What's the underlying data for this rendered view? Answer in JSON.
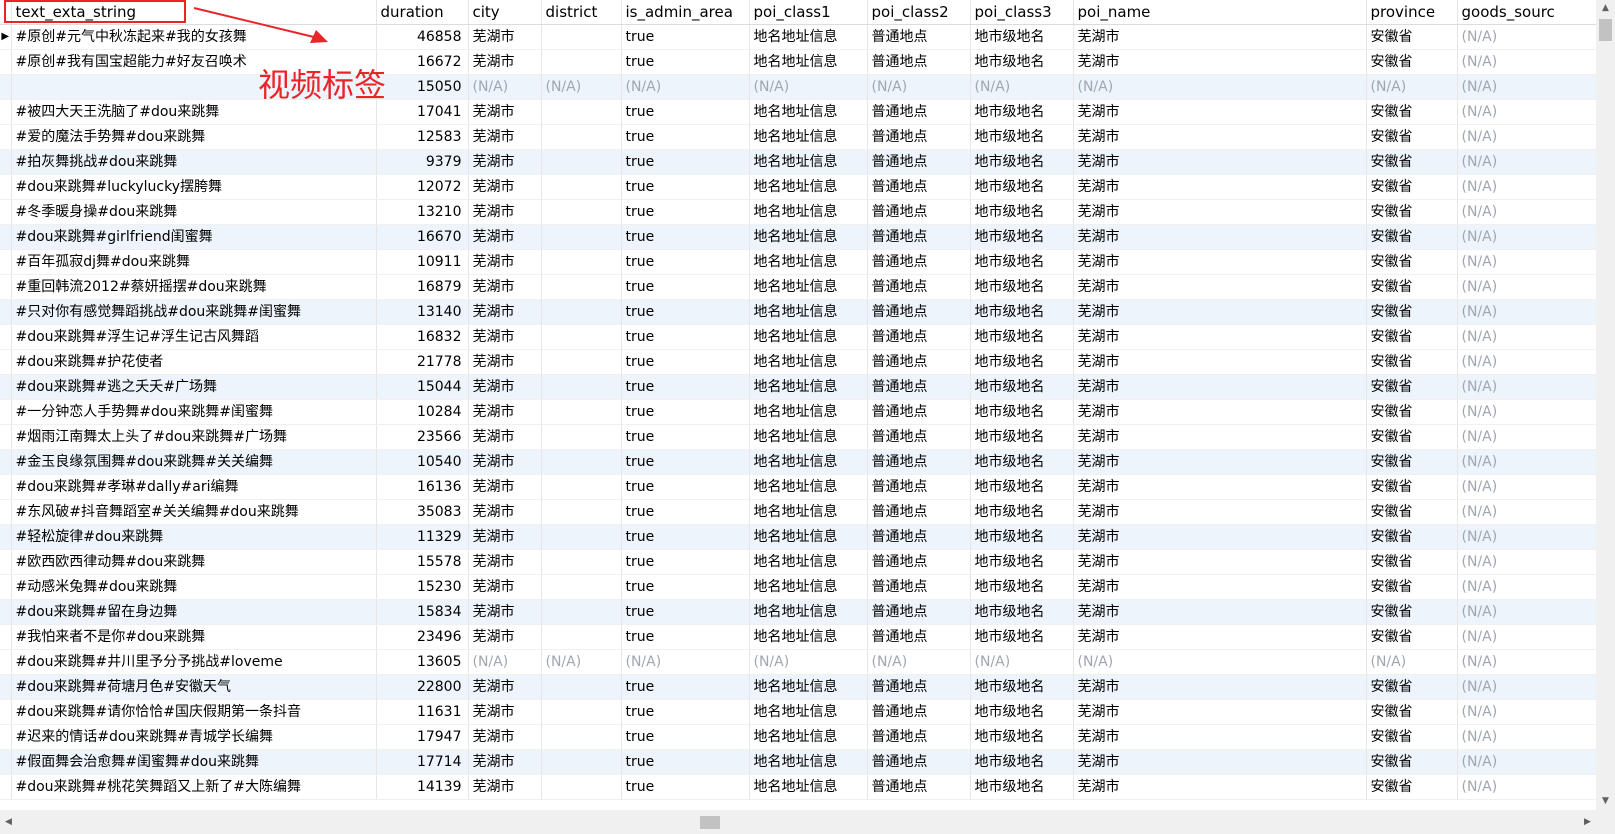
{
  "columns": [
    "text_exta_string",
    "duration",
    "city",
    "district",
    "is_admin_area",
    "poi_class1",
    "poi_class2",
    "poi_class3",
    "poi_name",
    "province",
    "goods_sourc"
  ],
  "na": "(N/A)",
  "annotation": {
    "label": "视频标签",
    "color": "#e8262a"
  },
  "rows": [
    [
      "#原创#元气中秋冻起来#我的女孩舞",
      "46858",
      "芜湖市",
      "",
      "true",
      "地名地址信息",
      "普通地点",
      "地市级地名",
      "芜湖市",
      "安徽省",
      "(N/A)"
    ],
    [
      "#原创#我有国宝超能力#好友召唤术",
      "16672",
      "芜湖市",
      "",
      "true",
      "地名地址信息",
      "普通地点",
      "地市级地名",
      "芜湖市",
      "安徽省",
      "(N/A)"
    ],
    [
      "",
      "15050",
      "(N/A)",
      "(N/A)",
      "(N/A)",
      "(N/A)",
      "(N/A)",
      "(N/A)",
      "(N/A)",
      "(N/A)",
      "(N/A)"
    ],
    [
      "#被四大天王洗脑了#dou来跳舞",
      "17041",
      "芜湖市",
      "",
      "true",
      "地名地址信息",
      "普通地点",
      "地市级地名",
      "芜湖市",
      "安徽省",
      "(N/A)"
    ],
    [
      "#爱的魔法手势舞#dou来跳舞",
      "12583",
      "芜湖市",
      "",
      "true",
      "地名地址信息",
      "普通地点",
      "地市级地名",
      "芜湖市",
      "安徽省",
      "(N/A)"
    ],
    [
      "#拍灰舞挑战#dou来跳舞",
      "9379",
      "芜湖市",
      "",
      "true",
      "地名地址信息",
      "普通地点",
      "地市级地名",
      "芜湖市",
      "安徽省",
      "(N/A)"
    ],
    [
      "#dou来跳舞#luckylucky摆胯舞",
      "12072",
      "芜湖市",
      "",
      "true",
      "地名地址信息",
      "普通地点",
      "地市级地名",
      "芜湖市",
      "安徽省",
      "(N/A)"
    ],
    [
      "#冬季暖身操#dou来跳舞",
      "13210",
      "芜湖市",
      "",
      "true",
      "地名地址信息",
      "普通地点",
      "地市级地名",
      "芜湖市",
      "安徽省",
      "(N/A)"
    ],
    [
      "#dou来跳舞#girlfriend闺蜜舞",
      "16670",
      "芜湖市",
      "",
      "true",
      "地名地址信息",
      "普通地点",
      "地市级地名",
      "芜湖市",
      "安徽省",
      "(N/A)"
    ],
    [
      "#百年孤寂dj舞#dou来跳舞",
      "10911",
      "芜湖市",
      "",
      "true",
      "地名地址信息",
      "普通地点",
      "地市级地名",
      "芜湖市",
      "安徽省",
      "(N/A)"
    ],
    [
      "#重回韩流2012#蔡妍摇摆#dou来跳舞",
      "16879",
      "芜湖市",
      "",
      "true",
      "地名地址信息",
      "普通地点",
      "地市级地名",
      "芜湖市",
      "安徽省",
      "(N/A)"
    ],
    [
      "#只对你有感觉舞蹈挑战#dou来跳舞#闺蜜舞",
      "13140",
      "芜湖市",
      "",
      "true",
      "地名地址信息",
      "普通地点",
      "地市级地名",
      "芜湖市",
      "安徽省",
      "(N/A)"
    ],
    [
      "#dou来跳舞#浮生记#浮生记古风舞蹈",
      "16832",
      "芜湖市",
      "",
      "true",
      "地名地址信息",
      "普通地点",
      "地市级地名",
      "芜湖市",
      "安徽省",
      "(N/A)"
    ],
    [
      "#dou来跳舞#护花使者",
      "21778",
      "芜湖市",
      "",
      "true",
      "地名地址信息",
      "普通地点",
      "地市级地名",
      "芜湖市",
      "安徽省",
      "(N/A)"
    ],
    [
      "#dou来跳舞#逃之夭夭#广场舞",
      "15044",
      "芜湖市",
      "",
      "true",
      "地名地址信息",
      "普通地点",
      "地市级地名",
      "芜湖市",
      "安徽省",
      "(N/A)"
    ],
    [
      "#一分钟恋人手势舞#dou来跳舞#闺蜜舞",
      "10284",
      "芜湖市",
      "",
      "true",
      "地名地址信息",
      "普通地点",
      "地市级地名",
      "芜湖市",
      "安徽省",
      "(N/A)"
    ],
    [
      "#烟雨江南舞太上头了#dou来跳舞#广场舞",
      "23566",
      "芜湖市",
      "",
      "true",
      "地名地址信息",
      "普通地点",
      "地市级地名",
      "芜湖市",
      "安徽省",
      "(N/A)"
    ],
    [
      "#金玉良缘氛围舞#dou来跳舞#关关编舞",
      "10540",
      "芜湖市",
      "",
      "true",
      "地名地址信息",
      "普通地点",
      "地市级地名",
      "芜湖市",
      "安徽省",
      "(N/A)"
    ],
    [
      "#dou来跳舞#孝琳#dally#ari编舞",
      "16136",
      "芜湖市",
      "",
      "true",
      "地名地址信息",
      "普通地点",
      "地市级地名",
      "芜湖市",
      "安徽省",
      "(N/A)"
    ],
    [
      "#东风破#抖音舞蹈室#关关编舞#dou来跳舞",
      "35083",
      "芜湖市",
      "",
      "true",
      "地名地址信息",
      "普通地点",
      "地市级地名",
      "芜湖市",
      "安徽省",
      "(N/A)"
    ],
    [
      "#轻松旋律#dou来跳舞",
      "11329",
      "芜湖市",
      "",
      "true",
      "地名地址信息",
      "普通地点",
      "地市级地名",
      "芜湖市",
      "安徽省",
      "(N/A)"
    ],
    [
      "#欧西欧西律动舞#dou来跳舞",
      "15578",
      "芜湖市",
      "",
      "true",
      "地名地址信息",
      "普通地点",
      "地市级地名",
      "芜湖市",
      "安徽省",
      "(N/A)"
    ],
    [
      "#动感米兔舞#dou来跳舞",
      "15230",
      "芜湖市",
      "",
      "true",
      "地名地址信息",
      "普通地点",
      "地市级地名",
      "芜湖市",
      "安徽省",
      "(N/A)"
    ],
    [
      "#dou来跳舞#留在身边舞",
      "15834",
      "芜湖市",
      "",
      "true",
      "地名地址信息",
      "普通地点",
      "地市级地名",
      "芜湖市",
      "安徽省",
      "(N/A)"
    ],
    [
      "#我怕来者不是你#dou来跳舞",
      "23496",
      "芜湖市",
      "",
      "true",
      "地名地址信息",
      "普通地点",
      "地市级地名",
      "芜湖市",
      "安徽省",
      "(N/A)"
    ],
    [
      "#dou来跳舞#井川里予分予挑战#loveme",
      "13605",
      "(N/A)",
      "(N/A)",
      "(N/A)",
      "(N/A)",
      "(N/A)",
      "(N/A)",
      "(N/A)",
      "(N/A)",
      "(N/A)"
    ],
    [
      "#dou来跳舞#荷塘月色#安徽天气",
      "22800",
      "芜湖市",
      "",
      "true",
      "地名地址信息",
      "普通地点",
      "地市级地名",
      "芜湖市",
      "安徽省",
      "(N/A)"
    ],
    [
      "#dou来跳舞#请你恰恰#国庆假期第一条抖音",
      "11631",
      "芜湖市",
      "",
      "true",
      "地名地址信息",
      "普通地点",
      "地市级地名",
      "芜湖市",
      "安徽省",
      "(N/A)"
    ],
    [
      "#迟来的情话#dou来跳舞#青城学长编舞",
      "17947",
      "芜湖市",
      "",
      "true",
      "地名地址信息",
      "普通地点",
      "地市级地名",
      "芜湖市",
      "安徽省",
      "(N/A)"
    ],
    [
      "#假面舞会治愈舞#闺蜜舞#dou来跳舞",
      "17714",
      "芜湖市",
      "",
      "true",
      "地名地址信息",
      "普通地点",
      "地市级地名",
      "芜湖市",
      "安徽省",
      "(N/A)"
    ],
    [
      "#dou来跳舞#桃花笑舞蹈又上新了#大陈编舞",
      "14139",
      "芜湖市",
      "",
      "true",
      "地名地址信息",
      "普通地点",
      "地市级地名",
      "芜湖市",
      "安徽省",
      "(N/A)"
    ]
  ]
}
